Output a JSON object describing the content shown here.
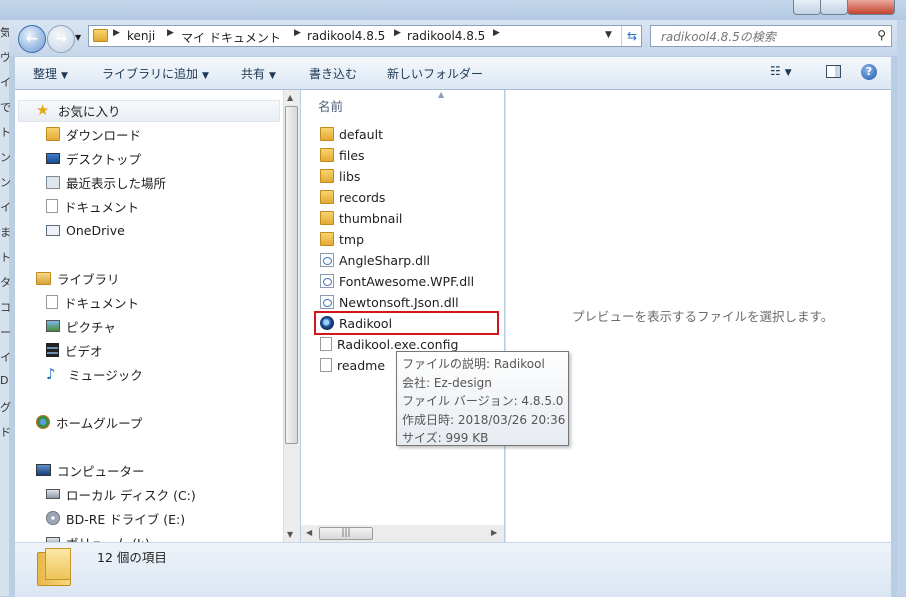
{
  "left_strip_chars": [
    "気",
    "ヴ",
    "イ",
    "で",
    "ト",
    "ン",
    "ン",
    "イ",
    "ま",
    "ト",
    "タ",
    "コ",
    "ー",
    "イ",
    "D",
    "グ",
    "ド"
  ],
  "address_bar": {
    "breadcrumbs": [
      "kenji",
      "マイ ドキュメント",
      "radikool4.8.5",
      "radikool4.8.5"
    ],
    "search_placeholder": "radikool4.8.5の検索"
  },
  "toolbar": {
    "organize": "整理",
    "add_to_library": "ライブラリに追加",
    "share": "共有",
    "burn": "書き込む",
    "new_folder": "新しいフォルダー"
  },
  "nav_pane": {
    "favorites": "お気に入り",
    "favorites_items": [
      "ダウンロード",
      "デスクトップ",
      "最近表示した場所",
      "ドキュメント",
      "OneDrive"
    ],
    "libraries": "ライブラリ",
    "library_items": [
      "ドキュメント",
      "ピクチャ",
      "ビデオ",
      "ミュージック"
    ],
    "homegroup": "ホームグループ",
    "computer": "コンピューター",
    "computer_items": [
      "ローカル ディスク (C:)",
      "BD-RE ドライブ (E:)",
      "ボリューム (I:)"
    ]
  },
  "file_list": {
    "column_name": "名前",
    "files": [
      {
        "name": "default",
        "type": "folder"
      },
      {
        "name": "files",
        "type": "folder"
      },
      {
        "name": "libs",
        "type": "folder"
      },
      {
        "name": "records",
        "type": "folder"
      },
      {
        "name": "thumbnail",
        "type": "folder"
      },
      {
        "name": "tmp",
        "type": "folder"
      },
      {
        "name": "AngleSharp.dll",
        "type": "dll"
      },
      {
        "name": "FontAwesome.WPF.dll",
        "type": "dll"
      },
      {
        "name": "Newtonsoft.Json.dll",
        "type": "dll"
      },
      {
        "name": "Radikool",
        "type": "app"
      },
      {
        "name": "Radikool.exe.config",
        "type": "text"
      },
      {
        "name": "readme",
        "type": "text"
      }
    ],
    "hscroll_grip": "|||"
  },
  "preview_text": "プレビューを表示するファイルを選択します。",
  "tooltip": {
    "description": "ファイルの説明: Radikool",
    "company": "会社: Ez-design",
    "version": "ファイル バージョン: 4.8.5.0",
    "created": "作成日時: 2018/03/26 20:36",
    "size": "サイズ: 999 KB"
  },
  "status": {
    "item_count": "12 個の項目"
  },
  "colors": {
    "highlight_border": "#d4161c",
    "window_frame": "#b9cde3"
  }
}
